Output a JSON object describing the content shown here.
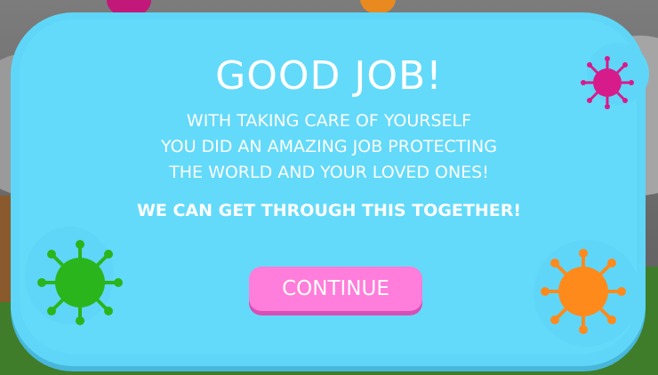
{
  "popup": {
    "title": "GOOD JOB!",
    "message_lines": [
      "WITH TAKING CARE OF YOURSELF",
      "YOU DID AN AMAZING JOB PROTECTING",
      "THE WORLD AND YOUR LOVED ONES!"
    ],
    "emphasis": "WE CAN GET THROUGH THIS TOGETHER!",
    "continue_label": "CONTINUE"
  },
  "colors": {
    "popup_bg": "#63dafa",
    "button_bg": "#ff7ddb",
    "virus_pink": "#d81b8a",
    "virus_green": "#2ab51c",
    "virus_orange": "#ff8a1c"
  },
  "icons": [
    "virus-icon-pink",
    "virus-icon-green",
    "virus-icon-orange"
  ]
}
